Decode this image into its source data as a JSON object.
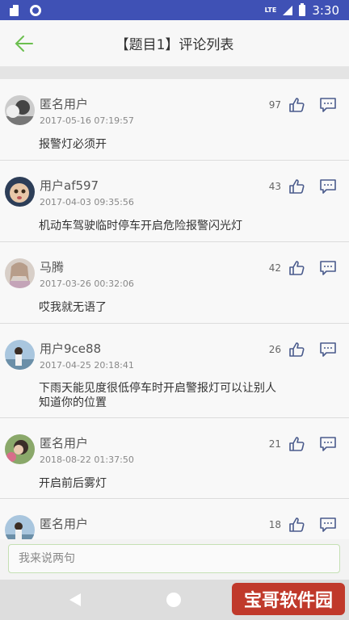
{
  "status_bar": {
    "time": "3:30",
    "network": "LTE",
    "bg_color": "#3f51b5"
  },
  "header": {
    "title": "【题目1】评论列表",
    "back_icon": "arrow-left-icon",
    "accent_color": "#6cbf4f"
  },
  "comments": [
    {
      "user": "匿名用户",
      "time": "2017-05-16 07:19:57",
      "content": "报警灯必须开",
      "likes": "97"
    },
    {
      "user": "用户af597",
      "time": "2017-04-03 09:35:56",
      "content": "机动车驾驶临时停车开启危险报警闪光灯",
      "likes": "43"
    },
    {
      "user": "马腾",
      "time": "2017-03-26 00:32:06",
      "content": "哎我就无语了",
      "likes": "42"
    },
    {
      "user": "用户9ce88",
      "time": "2017-04-25 20:18:41",
      "content": "下雨天能见度很低停车时开启警报灯可以让别人知道你的位置",
      "likes": "26"
    },
    {
      "user": "匿名用户",
      "time": "2018-08-22 01:37:50",
      "content": "开启前后雾灯",
      "likes": "21"
    },
    {
      "user": "匿名用户",
      "time": "",
      "content": "",
      "likes": "18"
    }
  ],
  "input": {
    "placeholder": "我来说两句",
    "value": ""
  },
  "watermark": {
    "text": "宝哥软件园"
  }
}
